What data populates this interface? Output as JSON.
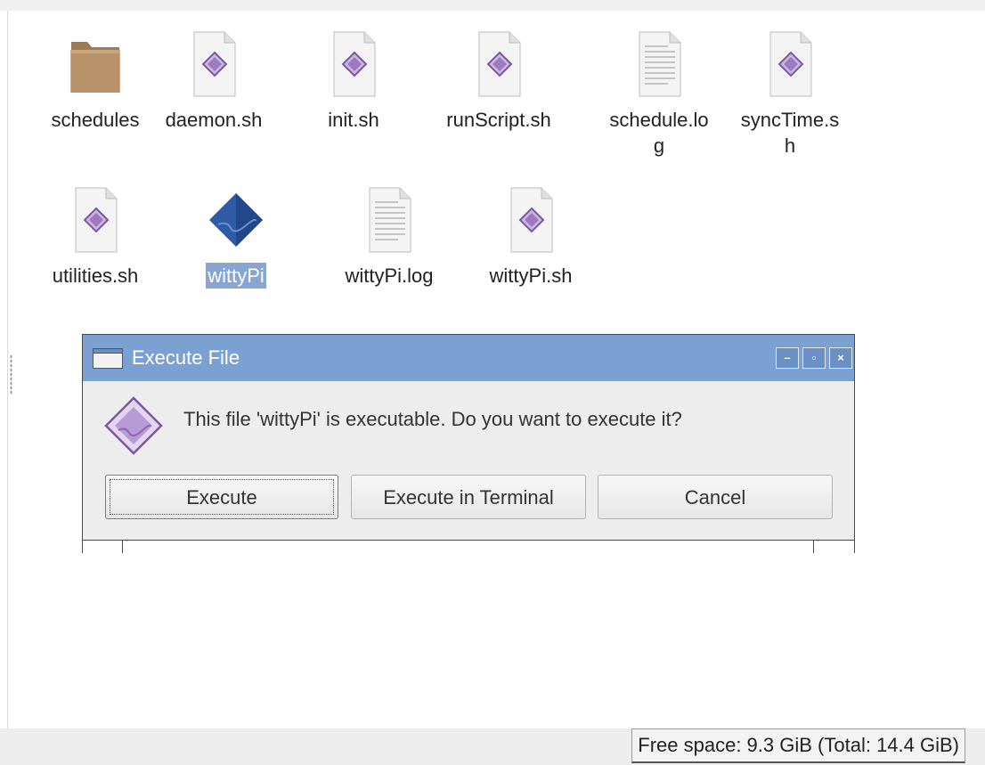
{
  "files": [
    {
      "name": "schedules",
      "icon": "folder-icon"
    },
    {
      "name": "daemon.sh",
      "icon": "script-icon"
    },
    {
      "name": "init.sh",
      "icon": "script-icon"
    },
    {
      "name": "runScript.sh",
      "icon": "script-icon"
    },
    {
      "name": "schedule.log",
      "icon": "text-file-icon"
    },
    {
      "name": "syncTime.sh",
      "icon": "script-icon"
    },
    {
      "name": "utilities.sh",
      "icon": "script-icon"
    },
    {
      "name": "wittyPi",
      "icon": "executable-icon",
      "selected": true
    },
    {
      "name": "wittyPi.log",
      "icon": "text-file-icon"
    },
    {
      "name": "wittyPi.sh",
      "icon": "script-icon"
    }
  ],
  "dialog": {
    "title": "Execute File",
    "message": "This file 'wittyPi' is executable. Do you want to execute it?",
    "buttons": {
      "execute": "Execute",
      "execute_terminal": "Execute in Terminal",
      "cancel": "Cancel"
    },
    "titlebar_buttons": {
      "minimize": "–",
      "maximize": "▫",
      "close": "×"
    }
  },
  "statusbar": {
    "free_space": "Free space: 9.3 GiB (Total: 14.4 GiB)"
  },
  "colors": {
    "titlebar": "#7ba1d2",
    "selection": "#87a7d2",
    "folder": "#b8936a"
  }
}
